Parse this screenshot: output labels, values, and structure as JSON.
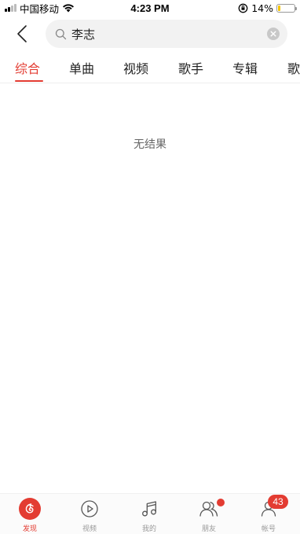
{
  "status_bar": {
    "carrier": "中国移动",
    "time": "4:23 PM",
    "battery_percent": "14%",
    "battery_level": 0.14
  },
  "search": {
    "query": "李志"
  },
  "tabs": [
    {
      "label": "综合",
      "active": true
    },
    {
      "label": "单曲"
    },
    {
      "label": "视频"
    },
    {
      "label": "歌手"
    },
    {
      "label": "专辑"
    },
    {
      "label": "歌"
    }
  ],
  "results": {
    "empty_message": "无结果"
  },
  "bottom_nav": {
    "items": [
      {
        "label": "发现",
        "icon": "netease-music-icon",
        "active": true
      },
      {
        "label": "视频",
        "icon": "play-video-icon"
      },
      {
        "label": "我的",
        "icon": "music-note-icon"
      },
      {
        "label": "朋友",
        "icon": "friends-icon",
        "has_dot": true
      },
      {
        "label": "帐号",
        "icon": "account-icon",
        "badge": "43"
      }
    ]
  },
  "colors": {
    "accent": "#e33c32",
    "battery": "#f5c400"
  }
}
